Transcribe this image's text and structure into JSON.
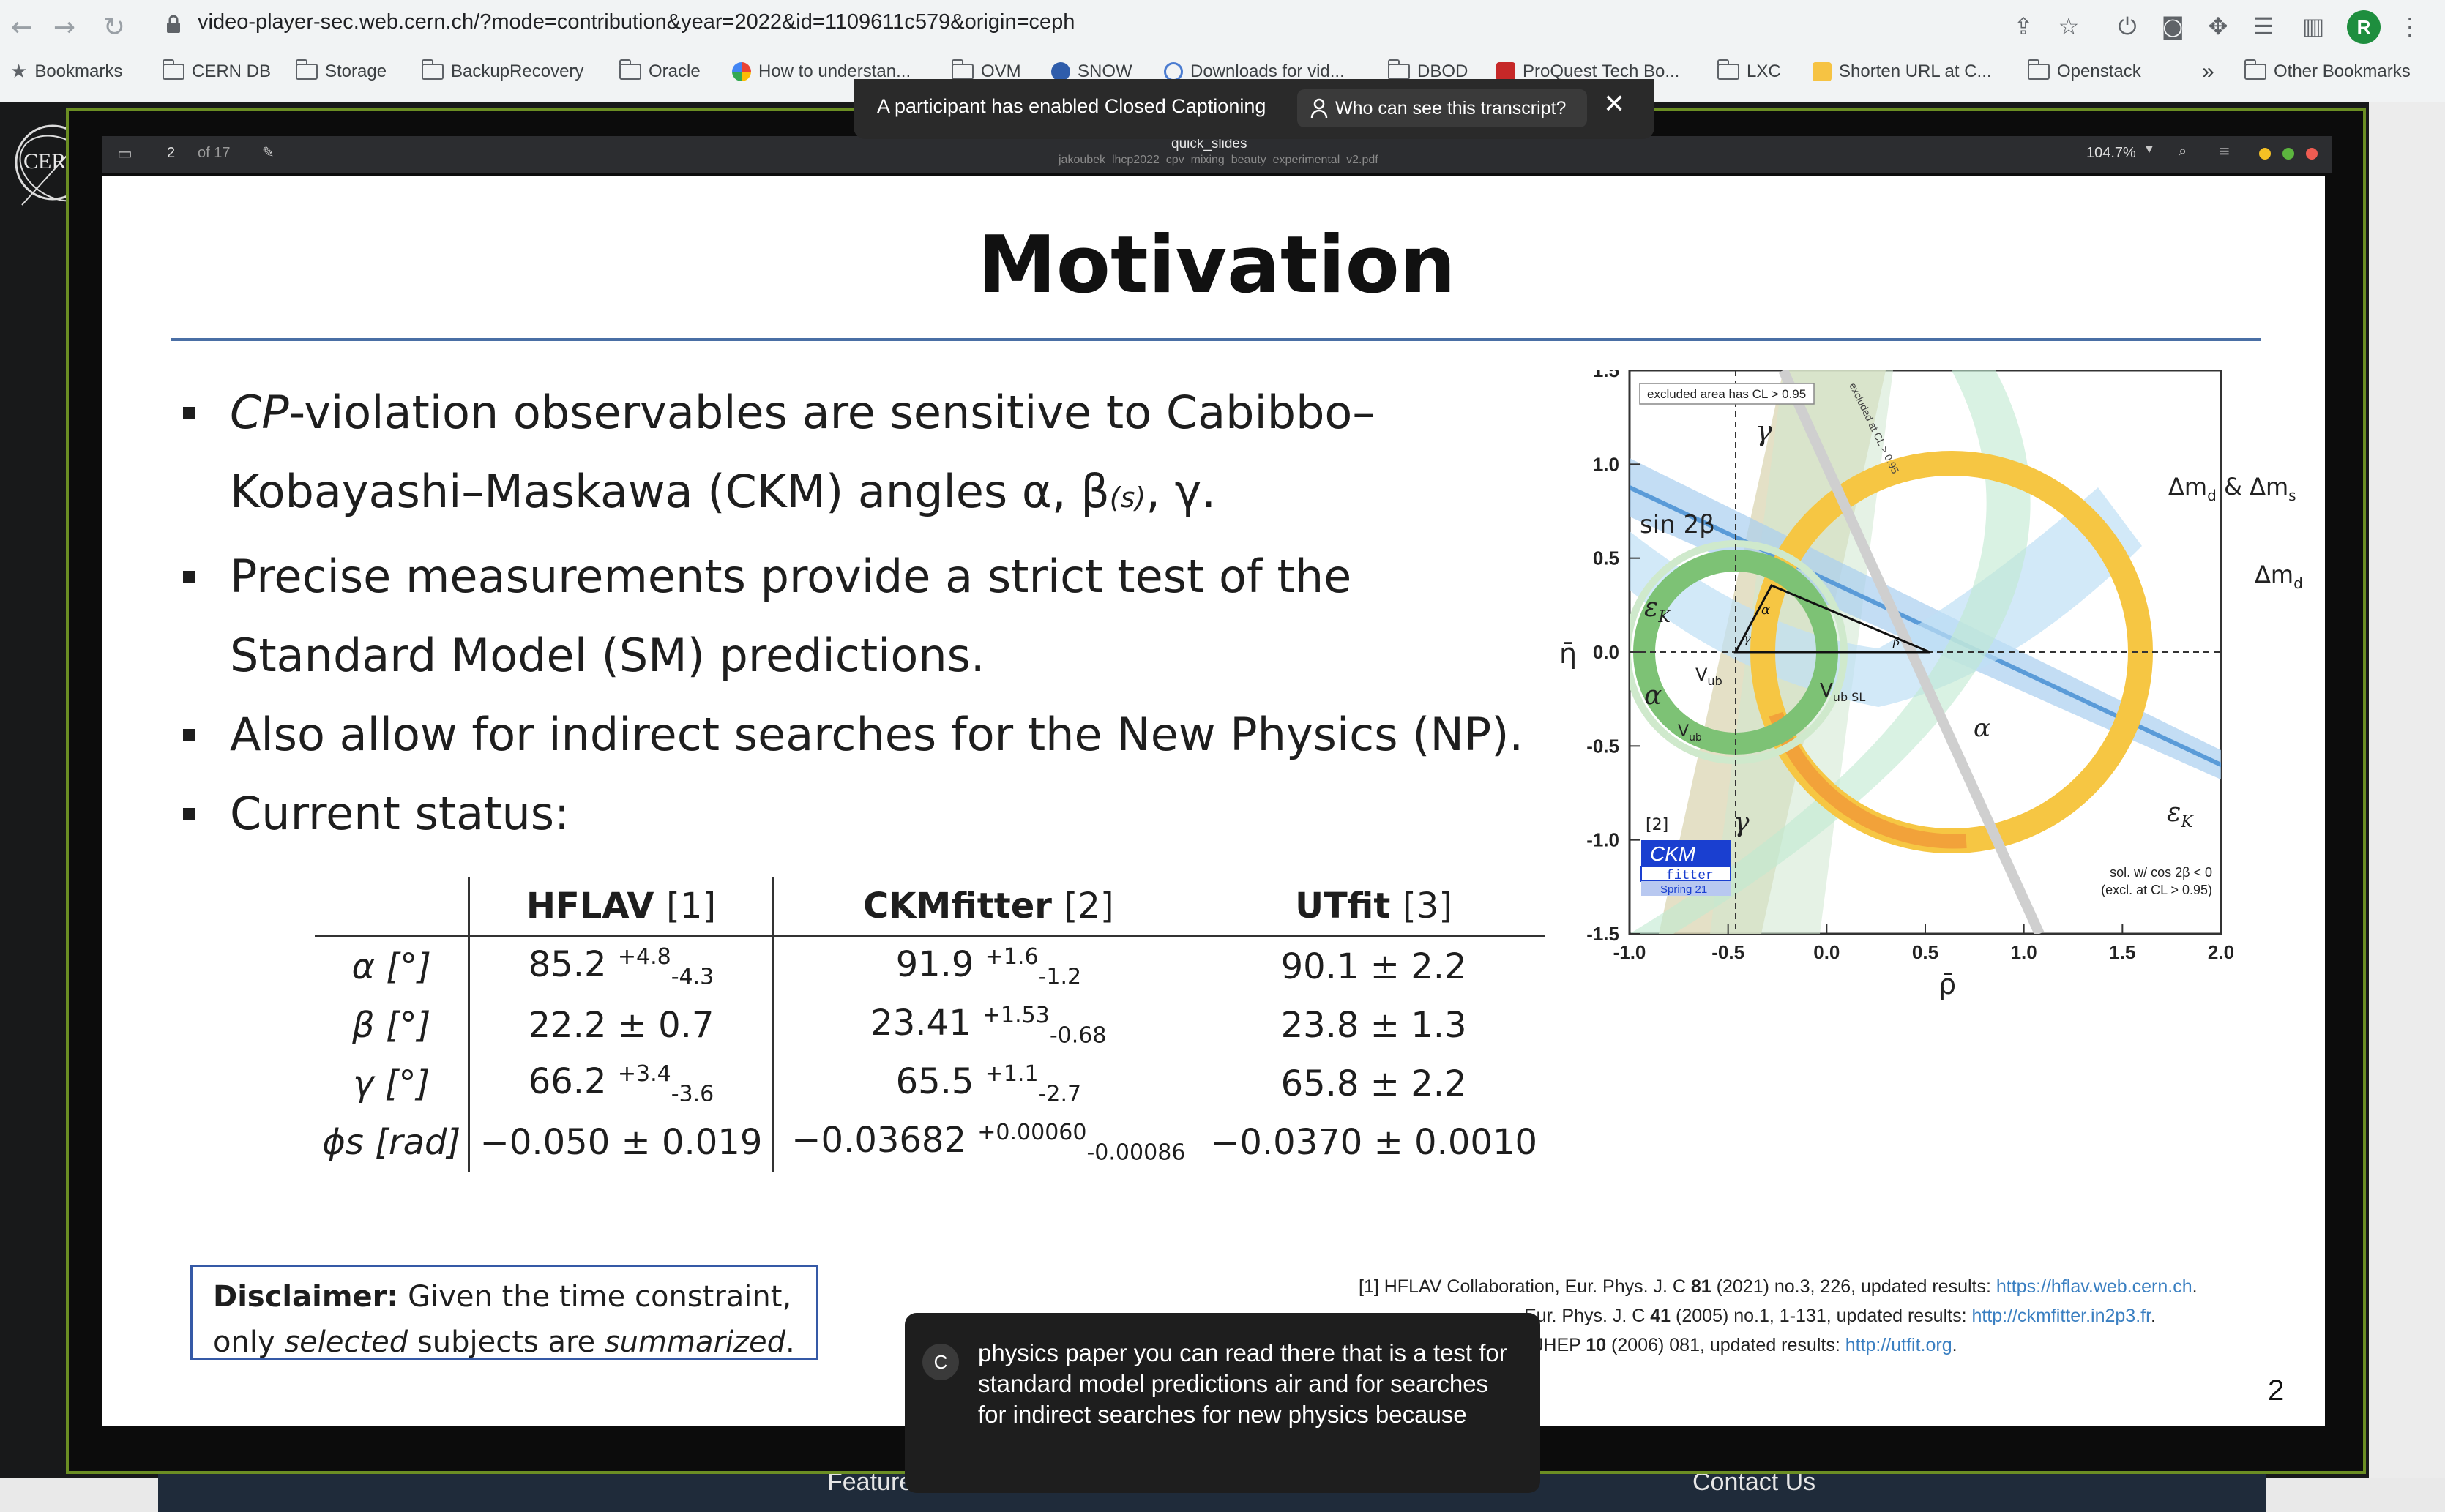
{
  "browser": {
    "url": "video-player-sec.web.cern.ch/?mode=contribution&year=2022&id=1109611c579&origin=ceph",
    "profile_initial": "R",
    "bookmarks": [
      {
        "label": "Bookmarks",
        "icon": "star-icon"
      },
      {
        "label": "CERN DB",
        "icon": "folder-icon"
      },
      {
        "label": "Storage",
        "icon": "folder-icon"
      },
      {
        "label": "BackupRecovery",
        "icon": "folder-icon"
      },
      {
        "label": "Oracle",
        "icon": "folder-icon"
      },
      {
        "label": "How to understan...",
        "icon": "favicon"
      },
      {
        "label": "OVM",
        "icon": "folder-icon"
      },
      {
        "label": "SNOW",
        "icon": "favicon"
      },
      {
        "label": "Downloads for vid...",
        "icon": "favicon"
      },
      {
        "label": "DBOD",
        "icon": "folder-icon"
      },
      {
        "label": "ProQuest Tech Bo...",
        "icon": "favicon"
      },
      {
        "label": "LXC",
        "icon": "folder-icon"
      },
      {
        "label": "Shorten URL at C...",
        "icon": "favicon"
      },
      {
        "label": "Openstack",
        "icon": "folder-icon"
      }
    ],
    "more_bookmarks": "»",
    "other_bookmarks": "Other Bookmarks"
  },
  "banner": {
    "text": "A participant has enabled Closed Captioning",
    "button": "Who can see this transcript?"
  },
  "viewer": {
    "page": "2",
    "page_total": "of 17",
    "doc_title": "quick_slides",
    "doc_file": "jakoubek_lhcp2022_cpv_mixing_beauty_experimental_v2.pdf",
    "zoom": "104.7%"
  },
  "slide": {
    "title": "Motivation",
    "bullets": {
      "b1_cp": "CP",
      "b1_line1": "-violation observables are sensitive to Cabibbo–",
      "b1_line2": "Kobayashi–Maskawa (CKM) angles α, β",
      "b1_sub": "(s)",
      "b1_end": ", γ.",
      "b2_line1": "Precise measurements provide a strict test of the",
      "b2_line2": "Standard Model (SM) predictions.",
      "b3": "Also allow for indirect searches for the New Physics (NP).",
      "b4": "Current status:"
    },
    "table": {
      "headers": [
        {
          "name": "HFLAV",
          "ref": "[1]"
        },
        {
          "name": "CKMfitter",
          "ref": "[2]"
        },
        {
          "name": "UTfit",
          "ref": "[3]"
        }
      ],
      "rows": [
        {
          "label": "α [°]",
          "hflav": "85.2",
          "hflav_sup": "+4.8",
          "hflav_sub": "-4.3",
          "ckm": "91.9",
          "ckm_sup": "+1.6",
          "ckm_sub": "-1.2",
          "utfit": "90.1 ± 2.2"
        },
        {
          "label": "β [°]",
          "hflav": "22.2 ± 0.7",
          "hflav_sup": "",
          "hflav_sub": "",
          "ckm": "23.41",
          "ckm_sup": "+1.53",
          "ckm_sub": "-0.68",
          "utfit": "23.8 ± 1.3"
        },
        {
          "label": "γ [°]",
          "hflav": "66.2",
          "hflav_sup": "+3.4",
          "hflav_sub": "-3.6",
          "ckm": "65.5",
          "ckm_sup": "+1.1",
          "ckm_sub": "-2.7",
          "utfit": "65.8 ± 2.2"
        },
        {
          "label": "ϕs [rad]",
          "hflav": "−0.050 ± 0.019",
          "hflav_sup": "",
          "hflav_sub": "",
          "ckm": "−0.03682",
          "ckm_sup": "+0.00060",
          "ckm_sub": "-0.00086",
          "utfit": "−0.0370 ± 0.0010"
        }
      ]
    },
    "disclaimer": {
      "bold": "Disclaimer:",
      "t1": " Given the time constraint,",
      "t2": "only ",
      "i1": "selected",
      "t3": " subjects are ",
      "i2": "summarized",
      "t4": "."
    },
    "references": [
      {
        "text_a": "[1] HFLAV Collaboration, Eur. Phys. J. C ",
        "bold": "81",
        "text_b": " (2021) no.3, 226, updated results: ",
        "link": "https://hflav.web.cern.ch",
        "end": "."
      },
      {
        "text_a": "Eur. Phys. J. C ",
        "bold": "41",
        "text_b": " (2005) no.1, 1-131, updated results: ",
        "link": "http://ckmfitter.in2p3.fr",
        "end": "."
      },
      {
        "text_a": ", JHEP ",
        "bold": "10",
        "text_b": " (2006) 081, updated results: ",
        "link": "http://utfit.org",
        "end": "."
      }
    ],
    "page_number": "2"
  },
  "ckm_plot": {
    "x_axis_label": "ρ̄",
    "y_axis_label": "η̄",
    "x_ticks": [
      "-1.0",
      "-0.5",
      "0.0",
      "0.5",
      "1.0",
      "1.5",
      "2.0"
    ],
    "y_ticks": [
      "1.5",
      "1.0",
      "0.5",
      "0.0",
      "-0.5",
      "-1.0",
      "-1.5"
    ],
    "labels": {
      "excluded": "excluded area has CL > 0.95",
      "gamma_top": "γ",
      "dm": "Δm",
      "dm_d": "d",
      "dm_amp": " & Δm",
      "dm_s": "s",
      "sin2b": "sin 2β",
      "dmd_right": "Δm",
      "dmd_right_sub": "d",
      "eps_left": "ε",
      "eps_left_sub": "K",
      "alpha_left": "α",
      "vub_inner": "V",
      "vub_inner_sub": "ub",
      "vub_sl": "V",
      "vub_sl_sub": "ub SL",
      "vub_lower": "V",
      "vub_lower_sub": "ub",
      "alpha_lower": "α",
      "ref": "[2]",
      "gamma_bottom": "γ",
      "eps_right": "ε",
      "eps_right_sub": "K",
      "sol": "sol. w/ cos 2β < 0",
      "excl": "(excl. at CL > 0.95)",
      "logo1": "CKM",
      "logo2": "fitter",
      "logo3": "Spring 21",
      "tri_alpha": "α",
      "tri_gamma": "γ",
      "tri_beta": "β",
      "excluded_diag": "excluded at CL > 0.95"
    }
  },
  "caption": {
    "initial": "C",
    "text": "physics paper you can read there that is a test for standard model predictions air and for searches for indirect searches for new physics because"
  },
  "page_footer": {
    "left": "Feature",
    "right": "Contact Us"
  }
}
